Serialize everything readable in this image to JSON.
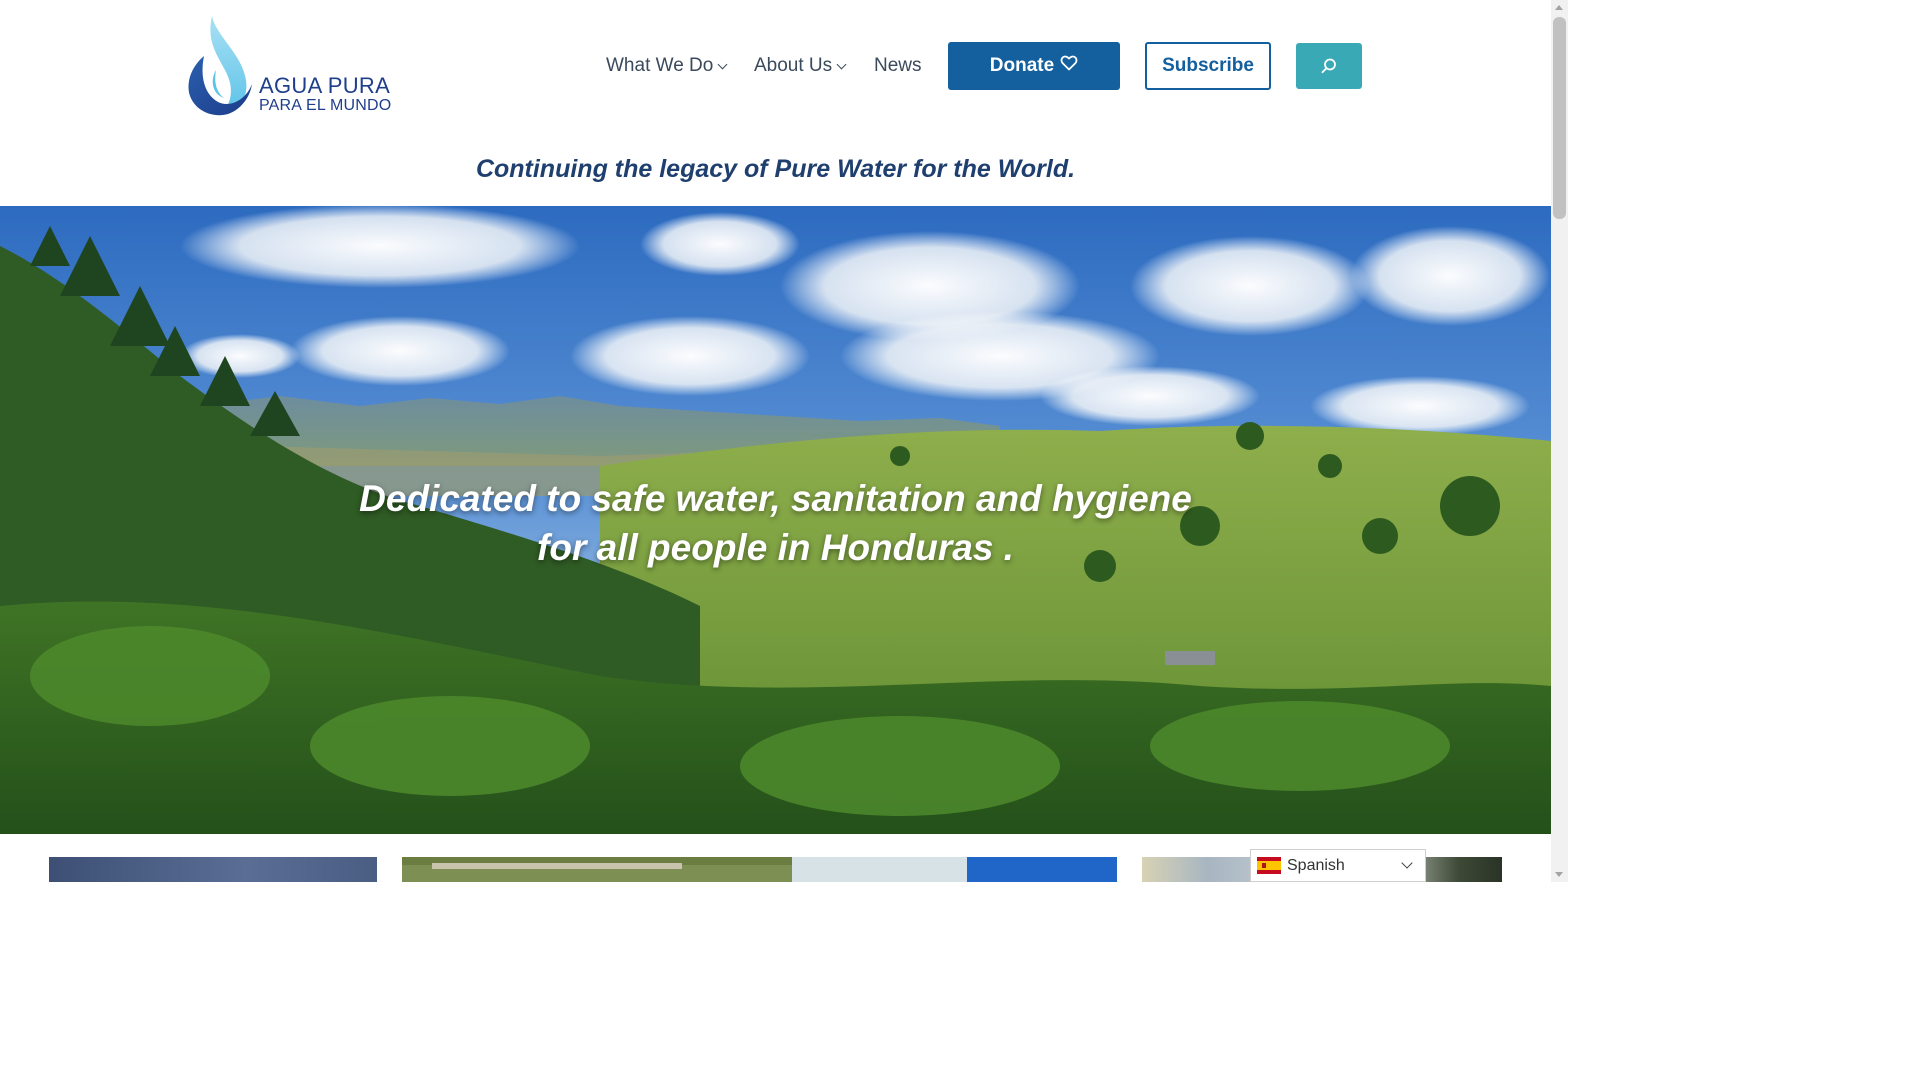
{
  "brand": {
    "name_line1": "AGUA PURA",
    "name_line2": "PARA EL MUNDO",
    "logo_icon": "water-drop-icon",
    "colors": {
      "navy": "#1f3f8c",
      "primary_blue": "#14609e",
      "teal": "#3aa9b6",
      "tagline": "#1f3f6e"
    }
  },
  "nav": {
    "items": [
      {
        "label": "What We Do",
        "has_dropdown": true
      },
      {
        "label": "About Us",
        "has_dropdown": true
      },
      {
        "label": "News",
        "has_dropdown": false
      }
    ],
    "donate_label": "Donate",
    "donate_icon": "heart-icon",
    "subscribe_label": "Subscribe",
    "search_icon": "search-icon"
  },
  "tagline": "Continuing the legacy of Pure Water for the World.",
  "hero": {
    "line1": "Dedicated to safe water, sanitation and hygiene",
    "line2": "for all people in Honduras ."
  },
  "language": {
    "selected": "Spanish",
    "flag_icon": "spain-flag-icon"
  }
}
